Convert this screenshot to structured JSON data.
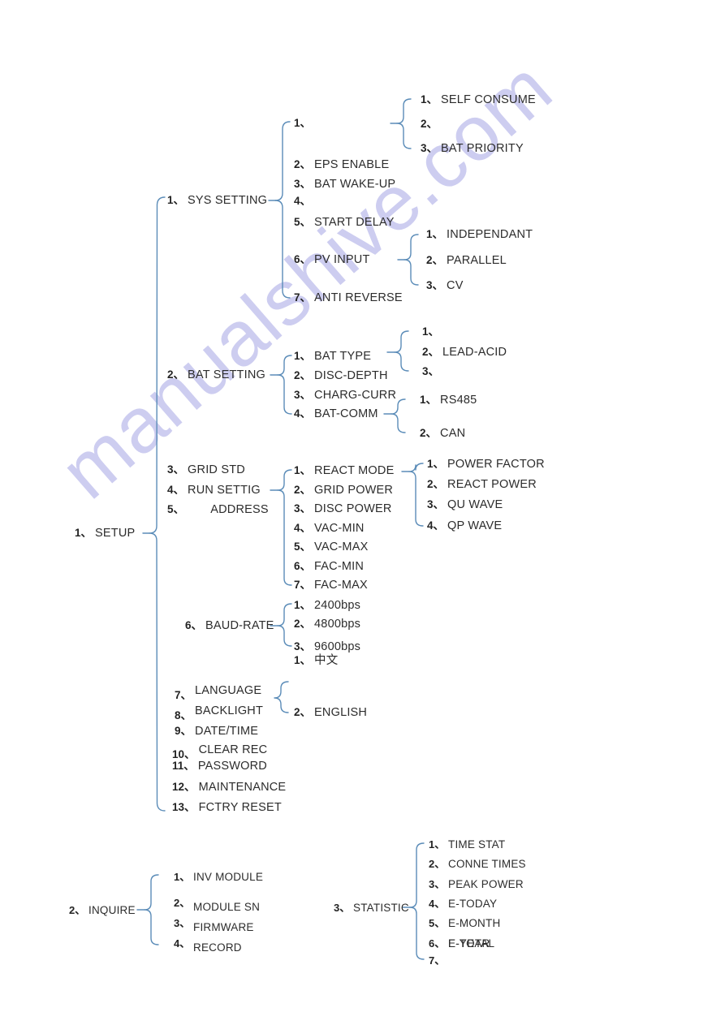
{
  "watermark": "manualshive.com",
  "colors": {
    "line": "#5b8cb8",
    "text": "#2c2c2c",
    "watermark": "#cdcdf0",
    "background": "#ffffff"
  },
  "separator": "、",
  "roots": [
    {
      "num": "1",
      "label": "SETUP"
    },
    {
      "num": "2",
      "label": "INQUIRE"
    },
    {
      "num": "3",
      "label": "STATISTIC"
    }
  ],
  "setup": {
    "num": "1",
    "label": "SETUP",
    "items": [
      {
        "num": "1",
        "label": "SYS SETTING"
      },
      {
        "num": "2",
        "label": "BAT SETTING"
      },
      {
        "num": "3",
        "label": "GRID STD"
      },
      {
        "num": "4",
        "label": "RUN SETTIG"
      },
      {
        "num": "5",
        "label": "ADDRESS"
      },
      {
        "num": "6",
        "label": "BAUD-RATE"
      },
      {
        "num": "7",
        "label": "LANGUAGE"
      },
      {
        "num": "8",
        "label": "BACKLIGHT"
      },
      {
        "num": "9",
        "label": "DATE/TIME"
      },
      {
        "num": "10",
        "label": "CLEAR REC"
      },
      {
        "num": "11",
        "label": "PASSWORD"
      },
      {
        "num": "12",
        "label": "MAINTENANCE"
      },
      {
        "num": "13",
        "label": "FCTRY RESET"
      }
    ]
  },
  "sys_setting": {
    "items": [
      {
        "num": "1",
        "label": ""
      },
      {
        "num": "2",
        "label": "EPS ENABLE"
      },
      {
        "num": "3",
        "label": "BAT WAKE-UP"
      },
      {
        "num": "4",
        "label": ""
      },
      {
        "num": "5",
        "label": "START DELAY"
      },
      {
        "num": "6",
        "label": "PV INPUT"
      },
      {
        "num": "7",
        "label": "ANTI REVERSE"
      }
    ]
  },
  "work_mode": {
    "items": [
      {
        "num": "1",
        "label": "SELF CONSUME"
      },
      {
        "num": "2",
        "label": ""
      },
      {
        "num": "3",
        "label": "BAT PRIORITY"
      }
    ]
  },
  "pv_input": {
    "items": [
      {
        "num": "1",
        "label": "INDEPENDANT"
      },
      {
        "num": "2",
        "label": "PARALLEL"
      },
      {
        "num": "3",
        "label": "CV"
      }
    ]
  },
  "bat_setting": {
    "items": [
      {
        "num": "1",
        "label": "BAT TYPE"
      },
      {
        "num": "2",
        "label": "DISC-DEPTH"
      },
      {
        "num": "3",
        "label": "CHARG-CURR"
      },
      {
        "num": "4",
        "label": "BAT-COMM"
      }
    ]
  },
  "bat_type": {
    "items": [
      {
        "num": "1",
        "label": ""
      },
      {
        "num": "2",
        "label": "LEAD-ACID"
      },
      {
        "num": "3",
        "label": ""
      }
    ]
  },
  "bat_comm": {
    "items": [
      {
        "num": "1",
        "label": "RS485"
      },
      {
        "num": "2",
        "label": "CAN"
      }
    ]
  },
  "run_settig": {
    "items": [
      {
        "num": "1",
        "label": "REACT MODE"
      },
      {
        "num": "2",
        "label": "GRID POWER"
      },
      {
        "num": "3",
        "label": "DISC POWER"
      },
      {
        "num": "4",
        "label": "VAC-MIN"
      },
      {
        "num": "5",
        "label": "VAC-MAX"
      },
      {
        "num": "6",
        "label": "FAC-MIN"
      },
      {
        "num": "7",
        "label": "FAC-MAX"
      }
    ]
  },
  "react_mode": {
    "items": [
      {
        "num": "1",
        "label": "POWER FACTOR"
      },
      {
        "num": "2",
        "label": "REACT POWER"
      },
      {
        "num": "3",
        "label": "QU WAVE"
      },
      {
        "num": "4",
        "label": "QP WAVE"
      }
    ]
  },
  "baud_rate": {
    "items": [
      {
        "num": "1",
        "label": "2400bps"
      },
      {
        "num": "2",
        "label": "4800bps"
      },
      {
        "num": "3",
        "label": "9600bps"
      }
    ]
  },
  "language": {
    "items": [
      {
        "num": "1",
        "label": "中文"
      },
      {
        "num": "2",
        "label": "ENGLISH"
      }
    ]
  },
  "inquire": {
    "num": "2",
    "label": "INQUIRE",
    "items": [
      {
        "num": "1",
        "label": "INV MODULE"
      },
      {
        "num": "2",
        "label": "MODULE SN"
      },
      {
        "num": "3",
        "label": "FIRMWARE"
      },
      {
        "num": "4",
        "label": "RECORD"
      }
    ]
  },
  "statistic": {
    "num": "3",
    "label": "STATISTIC",
    "items": [
      {
        "num": "1",
        "label": "TIME STAT"
      },
      {
        "num": "2",
        "label": "CONNE TIMES"
      },
      {
        "num": "3",
        "label": "PEAK POWER"
      },
      {
        "num": "4",
        "label": "E-TODAY"
      },
      {
        "num": "5",
        "label": "E-MONTH"
      },
      {
        "num": "6",
        "label": "E-YEAR",
        "label_overlap": "E-TOTAL"
      },
      {
        "num": "7",
        "label": ""
      }
    ]
  }
}
